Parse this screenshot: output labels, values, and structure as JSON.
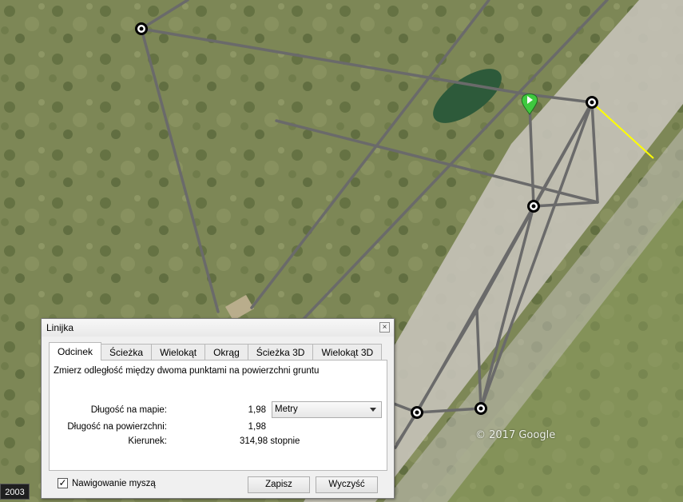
{
  "map": {
    "copyright": "© 2017 Google",
    "year_badge": "2003",
    "ruler_line_color": "#ffff00",
    "overlay_line_color": "#6a6a6a",
    "placemark_color": "#3fc93f"
  },
  "dialog": {
    "title": "Linijka",
    "close_symbol": "×",
    "tabs": [
      {
        "label": "Odcinek",
        "active": true
      },
      {
        "label": "Ścieżka",
        "active": false
      },
      {
        "label": "Wielokąt",
        "active": false
      },
      {
        "label": "Okrąg",
        "active": false
      },
      {
        "label": "Ścieżka 3D",
        "active": false
      },
      {
        "label": "Wielokąt 3D",
        "active": false
      }
    ],
    "description": "Zmierz odległość między dwoma punktami na powierzchni gruntu",
    "map_length": {
      "label": "Długość na mapie:",
      "value": "1,98",
      "unit": "Metry"
    },
    "ground_length": {
      "label": "Długość na powierzchni:",
      "value": "1,98"
    },
    "heading": {
      "label": "Kierunek:",
      "value": "314,98 stopnie"
    },
    "mouse_nav": {
      "label": "Nawigowanie myszą",
      "checked": true,
      "check_symbol": "✓"
    },
    "save_label": "Zapisz",
    "clear_label": "Wyczyść"
  }
}
